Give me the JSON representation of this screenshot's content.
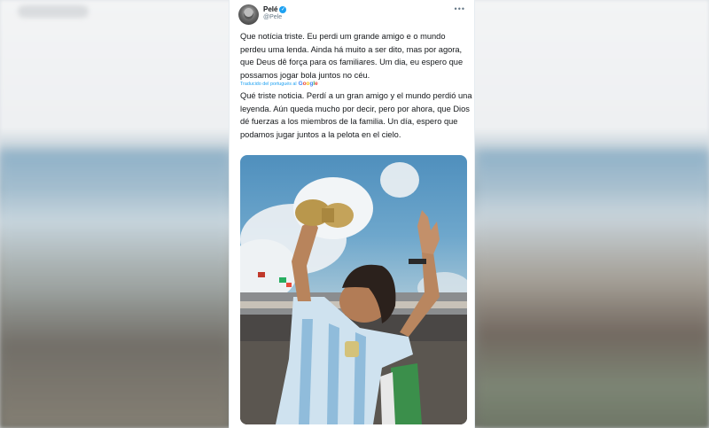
{
  "tweet": {
    "author_name": "Pelé",
    "author_handle": "@Pele",
    "text": "Que notícia triste. Eu perdi um grande amigo e o mundo perdeu uma lenda. Ainda há muito a ser dito, mas por agora, que Deus dê força para os familiares. Um dia, eu espero que possamos jogar bola juntos no céu.",
    "translated_from": "Traducido del portugués al",
    "translation_provider": "Google",
    "translation": "Qué triste noticia. Perdí a un gran amigo y el mundo perdió una leyenda. Aún queda mucho por decir, pero por ahora, que Dios dé fuerzas a los miembros de la familia. Un día, espero que podamos jugar juntos a la pelota en el cielo."
  },
  "icons": {
    "verified": "verified-badge-icon",
    "more": "more-options-icon",
    "avatar": "profile-avatar"
  },
  "colors": {
    "link": "#1da1f2",
    "text": "#14171a",
    "secondary": "#657786"
  }
}
